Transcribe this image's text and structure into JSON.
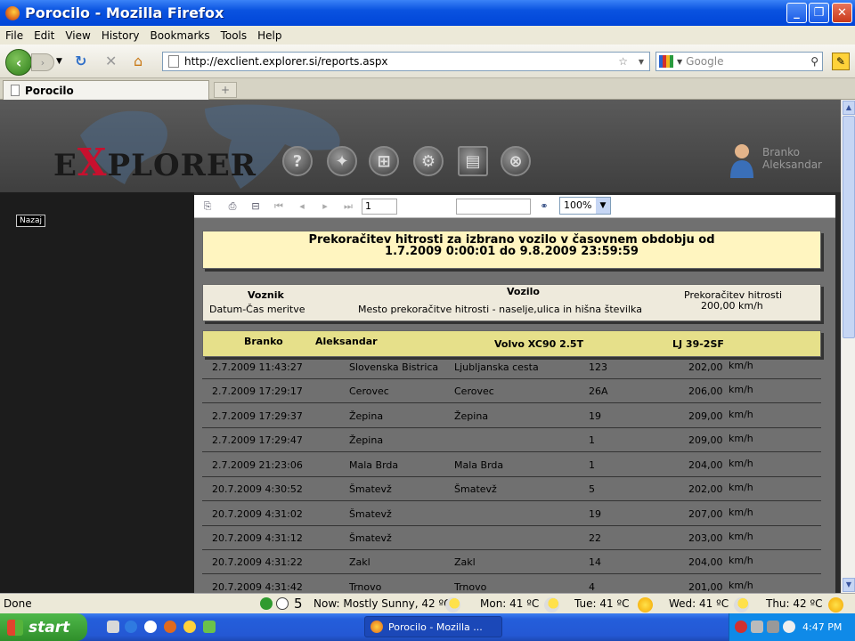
{
  "window": {
    "title": "Porocilo - Mozilla Firefox"
  },
  "menu": [
    "File",
    "Edit",
    "View",
    "History",
    "Bookmarks",
    "Tools",
    "Help"
  ],
  "nav": {
    "url": "http://exclient.explorer.si/reports.aspx",
    "search_placeholder": "Google"
  },
  "tab": {
    "label": "Porocilo"
  },
  "site": {
    "logo_pre": "E",
    "logo_x": "X",
    "logo_post": "PLORER",
    "user_first": "Branko",
    "user_last": "Aleksandar",
    "back_button": "Nazaj"
  },
  "report_toolbar": {
    "page": "1",
    "zoom": "100%"
  },
  "report": {
    "title_line1": "Prekoračitev hitrosti za izbrano vozilo v časovnem obdobju od",
    "title_line2": "1.7.2009   0:00:01 do  9.8.2009  23:59:59",
    "col_driver": "Voznik",
    "col_datetime": "Datum-Čas meritve",
    "col_vehicle": "Vozilo",
    "col_place": "Mesto prekoračitve hitrosti - naselje,ulica in hišna številka",
    "col_speed": "Prekoračitev hitrosti",
    "col_speed_value": "200,00 km/h",
    "driver_first": "Branko",
    "driver_last": "Aleksandar",
    "vehicle": "Volvo XC90 2.5T",
    "plate": "LJ 39-2SF",
    "rows": [
      {
        "dt": "2.7.2009  11:43:27",
        "city": "Slovenska Bistrica",
        "street": "Ljubljanska cesta",
        "no": "123",
        "speed": "202,00",
        "unit": "km/h"
      },
      {
        "dt": "2.7.2009  17:29:17",
        "city": "Cerovec",
        "street": "Cerovec",
        "no": "26A",
        "speed": "206,00",
        "unit": "km/h"
      },
      {
        "dt": "2.7.2009  17:29:37",
        "city": "Žepina",
        "street": "Žepina",
        "no": "19",
        "speed": "209,00",
        "unit": "km/h"
      },
      {
        "dt": "2.7.2009  17:29:47",
        "city": "Žepina",
        "street": "",
        "no": "1",
        "speed": "209,00",
        "unit": "km/h"
      },
      {
        "dt": "2.7.2009  21:23:06",
        "city": "Mala Brda",
        "street": "Mala Brda",
        "no": "1",
        "speed": "204,00",
        "unit": "km/h"
      },
      {
        "dt": "20.7.2009   4:30:52",
        "city": "Šmatevž",
        "street": "Šmatevž",
        "no": "5",
        "speed": "202,00",
        "unit": "km/h"
      },
      {
        "dt": "20.7.2009   4:31:02",
        "city": "Šmatevž",
        "street": "",
        "no": "19",
        "speed": "207,00",
        "unit": "km/h"
      },
      {
        "dt": "20.7.2009   4:31:12",
        "city": "Šmatevž",
        "street": "",
        "no": "22",
        "speed": "203,00",
        "unit": "km/h"
      },
      {
        "dt": "20.7.2009   4:31:22",
        "city": "Zakl",
        "street": "Zakl",
        "no": "14",
        "speed": "204,00",
        "unit": "km/h"
      },
      {
        "dt": "20.7.2009   4:31:42",
        "city": "Trnovo",
        "street": "Trnovo",
        "no": "4",
        "speed": "201,00",
        "unit": "km/h"
      }
    ]
  },
  "status": {
    "text": "Done",
    "count": "5",
    "now": "Now: Mostly Sunny, 42 ºC",
    "mon": "Mon: 41 ºC",
    "tue": "Tue: 41 ºC",
    "wed": "Wed: 41 ºC",
    "thu": "Thu: 42 ºC"
  },
  "taskbar": {
    "start": "start",
    "window_button": "Porocilo - Mozilla ...",
    "clock": "4:47 PM"
  }
}
